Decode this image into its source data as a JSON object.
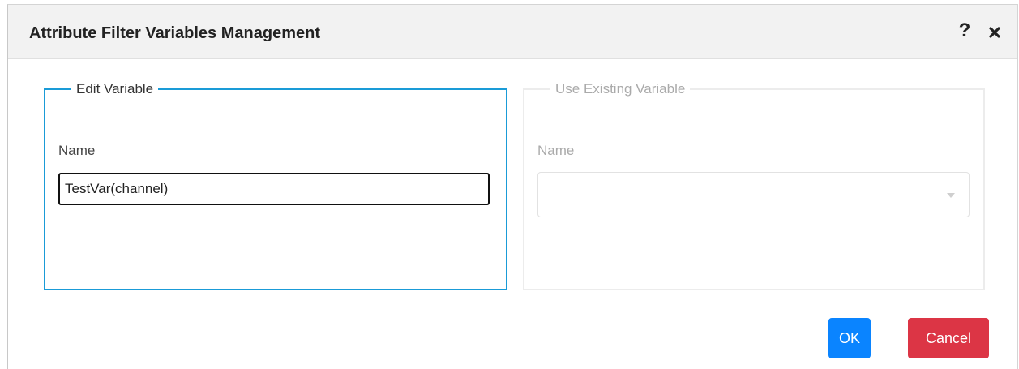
{
  "dialog": {
    "title": "Attribute Filter Variables Management",
    "help_glyph": "?",
    "close_icon": "close-icon"
  },
  "edit_panel": {
    "legend": "Edit Variable",
    "name_label": "Name",
    "name_value": "TestVar(channel)"
  },
  "existing_panel": {
    "legend": "Use Existing Variable",
    "name_label": "Name",
    "selected_value": ""
  },
  "buttons": {
    "ok": "OK",
    "cancel": "Cancel"
  },
  "colors": {
    "accent": "#1a9bd7",
    "ok": "#0a84ff",
    "cancel": "#dc3545"
  }
}
